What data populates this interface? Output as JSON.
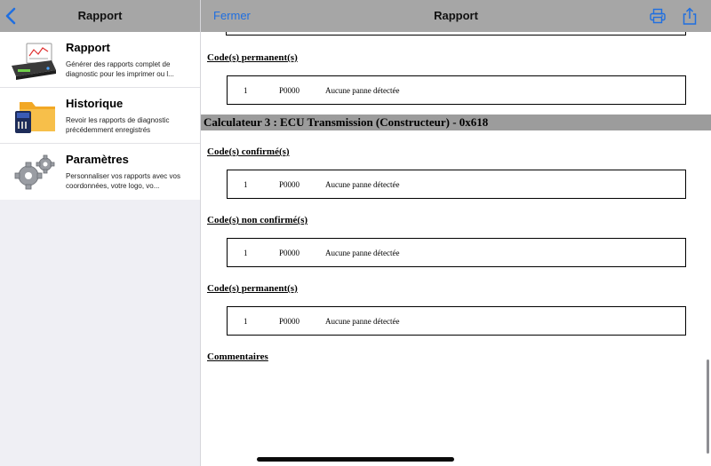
{
  "left_panel": {
    "title": "Rapport",
    "menu": [
      {
        "title": "Rapport",
        "description": "Générer des rapports complet de diagnostic pour les imprimer ou l...",
        "icon": "printer-report-icon"
      },
      {
        "title": "Historique",
        "description": "Revoir les rapports de diagnostic précédemment enregistrés",
        "icon": "folder-sdcard-icon"
      },
      {
        "title": "Paramètres",
        "description": "Personnaliser vos rapports avec vos coordonnées, votre logo, vo...",
        "icon": "gears-icon"
      }
    ]
  },
  "right_panel": {
    "close_label": "Fermer",
    "title": "Rapport",
    "icons": {
      "print": "printer-icon",
      "share": "share-icon"
    }
  },
  "report": {
    "section1_heading": "Code(s) permanent(s)",
    "row1": {
      "num": "1",
      "code": "P0000",
      "desc": "Aucune panne détectée"
    },
    "calc_header": "Calculateur 3 : ECU Transmission (Constructeur) - 0x618",
    "section2_heading": "Code(s) confirmé(s)",
    "row2": {
      "num": "1",
      "code": "P0000",
      "desc": "Aucune panne détectée"
    },
    "section3_heading": "Code(s) non confirmé(s)",
    "row3": {
      "num": "1",
      "code": "P0000",
      "desc": "Aucune panne détectée"
    },
    "section4_heading": "Code(s) permanent(s)",
    "row4": {
      "num": "1",
      "code": "P0000",
      "desc": "Aucune panne détectée"
    },
    "comments_heading": "Commentaires"
  },
  "colors": {
    "nav_bg": "#a6a6a6",
    "accent": "#1f6fe0",
    "calc_band": "#9c9c9c"
  }
}
